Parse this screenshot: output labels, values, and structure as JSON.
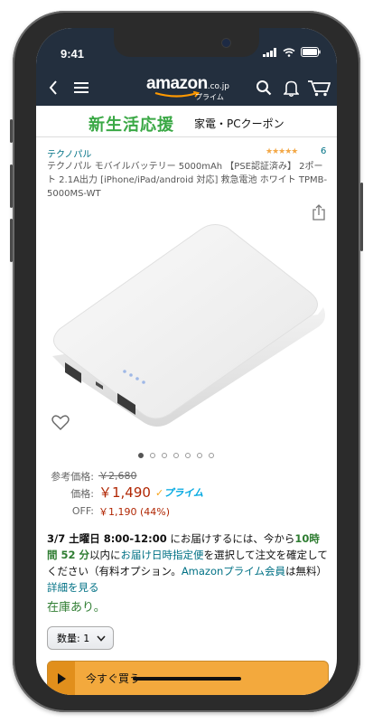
{
  "status": {
    "time": "9:41"
  },
  "nav": {
    "logo_main": "amazon",
    "logo_suffix": ".co.jp",
    "logo_sub": "プライム",
    "icons": [
      "back-arrow-icon",
      "hamburger-menu-icon",
      "search-icon",
      "bell-icon",
      "cart-icon"
    ]
  },
  "banner": {
    "highlight": "新生活応援",
    "text": "家電・PCクーポン"
  },
  "product": {
    "brand": "テクノパル",
    "stars": "★★★★★",
    "rating_count": "6",
    "title": "テクノパル モバイルバッテリー 5000mAh 【PSE認証済み】 2ポート 2.1A出力 [iPhone/iPad/android 対応] 救急電池 ホワイト TPMB-5000MS-WT",
    "image_dots": 7,
    "active_dot": 0
  },
  "pricing": {
    "list_label": "参考価格:",
    "list_price": "￥2,680",
    "price_label": "価格:",
    "price": "￥1,490",
    "prime": "プライム",
    "off_label": "OFF:",
    "off": "￥1,190 (44%)"
  },
  "delivery": {
    "date": "3/7 土曜日 8:00-12:00",
    "t1": " にお届けするには、今から",
    "hours": "10時間 52 分",
    "t2": "以内に",
    "link1": "お届け日時指定便",
    "t3": "を選択して注文を確定してください（有料オプション。",
    "link2": "Amazonプライム会員",
    "t4": "は無料）",
    "link3": "詳細を見る"
  },
  "stock": "在庫あり。",
  "quantity": {
    "label": "数量: 1"
  },
  "buy": {
    "label": "今すぐ買う"
  },
  "colors": {
    "nav_bg": "#232f3e",
    "accent": "#f3a93d",
    "price": "#b12704",
    "link": "#007185",
    "green": "#3aa845"
  }
}
